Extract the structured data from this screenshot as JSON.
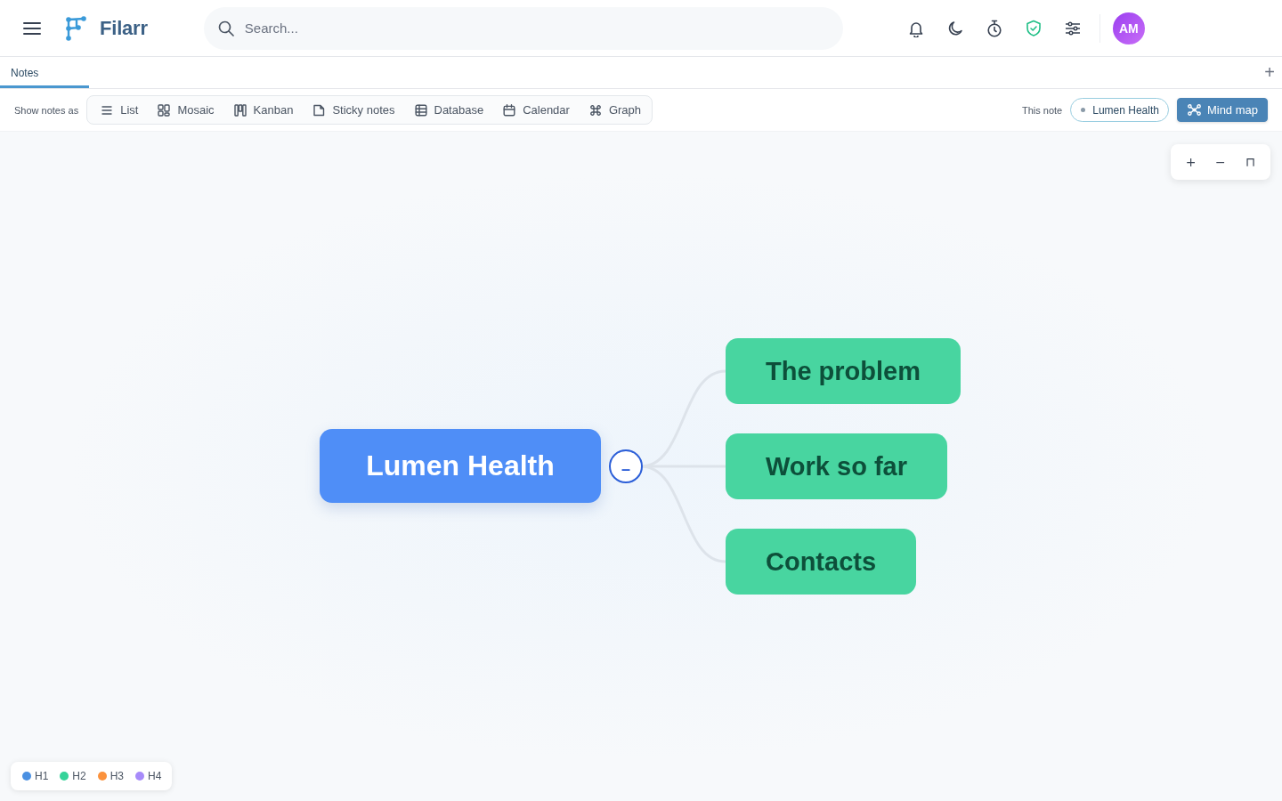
{
  "header": {
    "brand": "Filarr",
    "search": {
      "placeholder": "Search..."
    },
    "avatar": {
      "initials": "AM"
    }
  },
  "tabs": [
    {
      "label": "Notes",
      "selected": true
    }
  ],
  "tab_add": "+",
  "view_bar": {
    "label": "Show notes as",
    "views": [
      {
        "kind": "list",
        "label": "List",
        "selected": false
      },
      {
        "kind": "mosaic",
        "label": "Mosaic",
        "selected": false
      },
      {
        "kind": "kanban",
        "label": "Kanban",
        "selected": false
      },
      {
        "kind": "sticky",
        "label": "Sticky notes",
        "selected": false
      },
      {
        "kind": "database",
        "label": "Database",
        "selected": false
      },
      {
        "kind": "calendar",
        "label": "Calendar",
        "selected": false
      },
      {
        "kind": "graph",
        "label": "Graph",
        "selected": false
      }
    ],
    "scope_label": "This note",
    "note_chip": {
      "label": "Lumen Health"
    },
    "mind_map_button": {
      "label": "Mind map",
      "selected": true
    }
  },
  "zoom_controls": [
    "+",
    "−",
    "⊓"
  ],
  "mind_map": {
    "root": {
      "label": "Lumen Health",
      "color": "#4f8ef7",
      "expanded": true,
      "toggle": "–",
      "children": [
        {
          "label": "The problem",
          "color": "#48d5a0"
        },
        {
          "label": "Work so far",
          "color": "#48d5a0"
        },
        {
          "label": "Contacts",
          "color": "#48d5a0"
        }
      ]
    }
  },
  "legend": [
    {
      "label": "H1",
      "color": "#4a90e2"
    },
    {
      "label": "H2",
      "color": "#34d399"
    },
    {
      "label": "H3",
      "color": "#fb923c"
    },
    {
      "label": "H4",
      "color": "#a78bfa"
    }
  ]
}
